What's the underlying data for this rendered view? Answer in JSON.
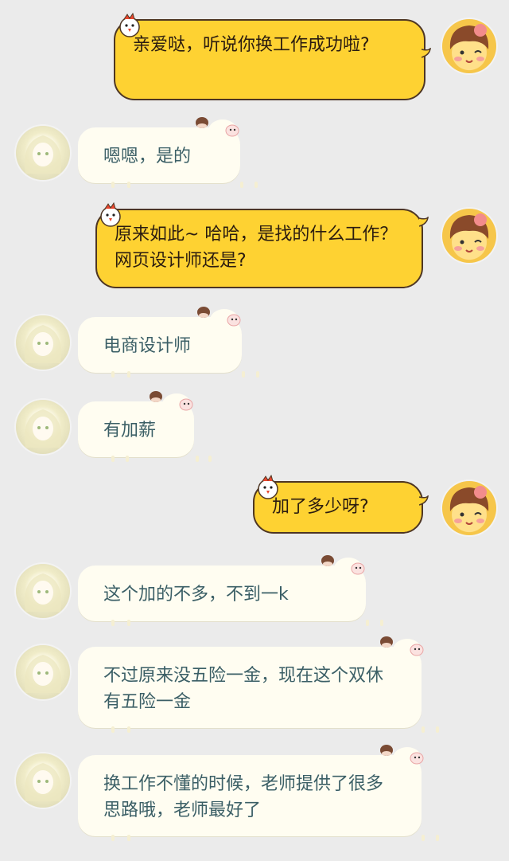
{
  "messages": [
    {
      "sender": "me",
      "text": "亲爱哒，听说你换工作成功啦?"
    },
    {
      "sender": "other",
      "text": "嗯嗯，是的"
    },
    {
      "sender": "me",
      "text": "原来如此~ 哈哈，是找的什么工作？网页设计师还是?"
    },
    {
      "sender": "other",
      "text": "电商设计师"
    },
    {
      "sender": "other",
      "text": "有加薪"
    },
    {
      "sender": "me",
      "text": "加了多少呀?"
    },
    {
      "sender": "other",
      "text": "这个加的不多，不到一k"
    },
    {
      "sender": "other",
      "text": "不过原来没五险一金，现在这个双休有五险一金"
    },
    {
      "sender": "other",
      "text": "换工作不懂的时候，老师提供了很多思路哦，老师最好了"
    }
  ],
  "colors": {
    "background": "#ebebeb",
    "my_bubble": "#fed232",
    "my_bubble_border": "#4e3623",
    "other_bubble": "#fffdf1",
    "other_text": "#3b5f66"
  },
  "icons": {
    "me_avatar": "cartoon-girl-avatar-icon",
    "other_avatar": "anime-girl-avatar-icon",
    "me_bubble_decoration": "chick-icon",
    "other_bubble_decoration": "sheep-icon"
  }
}
